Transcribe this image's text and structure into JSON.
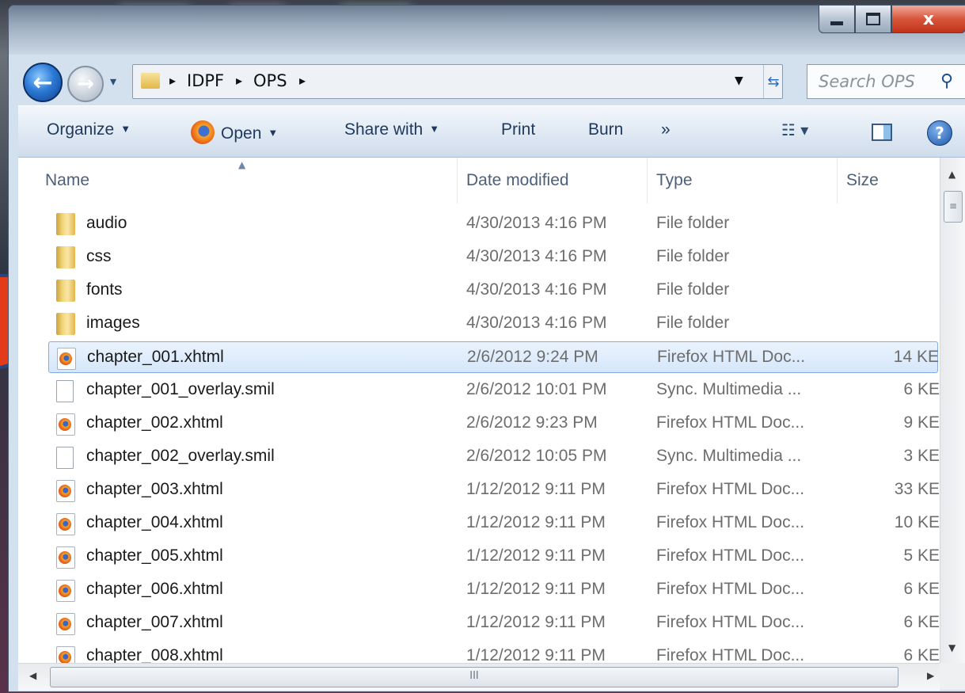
{
  "window": {
    "caption_close": "x"
  },
  "address": {
    "breadcrumbs": [
      "IDPF",
      "OPS"
    ],
    "separator": "▸"
  },
  "search": {
    "placeholder": "Search OPS"
  },
  "toolbar": {
    "organize": "Organize",
    "open": "Open",
    "share_with": "Share with",
    "print": "Print",
    "burn": "Burn",
    "more": "»"
  },
  "columns": {
    "name": "Name",
    "date_modified": "Date modified",
    "type": "Type",
    "size": "Size"
  },
  "files": [
    {
      "name": "audio",
      "date": "4/30/2013 4:16 PM",
      "type": "File folder",
      "size": "",
      "icon": "folder-icon"
    },
    {
      "name": "css",
      "date": "4/30/2013 4:16 PM",
      "type": "File folder",
      "size": "",
      "icon": "folder-icon"
    },
    {
      "name": "fonts",
      "date": "4/30/2013 4:16 PM",
      "type": "File folder",
      "size": "",
      "icon": "folder-icon"
    },
    {
      "name": "images",
      "date": "4/30/2013 4:16 PM",
      "type": "File folder",
      "size": "",
      "icon": "folder-icon"
    },
    {
      "name": "chapter_001.xhtml",
      "date": "2/6/2012 9:24 PM",
      "type": "Firefox HTML Doc...",
      "size": "14 KE",
      "icon": "firefox-document-icon",
      "selected": true
    },
    {
      "name": "chapter_001_overlay.smil",
      "date": "2/6/2012 10:01 PM",
      "type": "Sync. Multimedia ...",
      "size": "6 KE",
      "icon": "document-icon"
    },
    {
      "name": "chapter_002.xhtml",
      "date": "2/6/2012 9:23 PM",
      "type": "Firefox HTML Doc...",
      "size": "9 KE",
      "icon": "firefox-document-icon"
    },
    {
      "name": "chapter_002_overlay.smil",
      "date": "2/6/2012 10:05 PM",
      "type": "Sync. Multimedia ...",
      "size": "3 KE",
      "icon": "document-icon"
    },
    {
      "name": "chapter_003.xhtml",
      "date": "1/12/2012 9:11 PM",
      "type": "Firefox HTML Doc...",
      "size": "33 KE",
      "icon": "firefox-document-icon"
    },
    {
      "name": "chapter_004.xhtml",
      "date": "1/12/2012 9:11 PM",
      "type": "Firefox HTML Doc...",
      "size": "10 KE",
      "icon": "firefox-document-icon"
    },
    {
      "name": "chapter_005.xhtml",
      "date": "1/12/2012 9:11 PM",
      "type": "Firefox HTML Doc...",
      "size": "5 KE",
      "icon": "firefox-document-icon"
    },
    {
      "name": "chapter_006.xhtml",
      "date": "1/12/2012 9:11 PM",
      "type": "Firefox HTML Doc...",
      "size": "6 KE",
      "icon": "firefox-document-icon"
    },
    {
      "name": "chapter_007.xhtml",
      "date": "1/12/2012 9:11 PM",
      "type": "Firefox HTML Doc...",
      "size": "6 KE",
      "icon": "firefox-document-icon"
    },
    {
      "name": "chapter_008.xhtml",
      "date": "1/12/2012 9:11 PM",
      "type": "Firefox HTML Doc...",
      "size": "6 KE",
      "icon": "firefox-document-icon"
    }
  ],
  "scrollbar": {
    "grip": "≡",
    "hgrip": "III"
  },
  "colors": {
    "selection_border": "#84acdd",
    "annotation_arrow": "#e43b19"
  }
}
